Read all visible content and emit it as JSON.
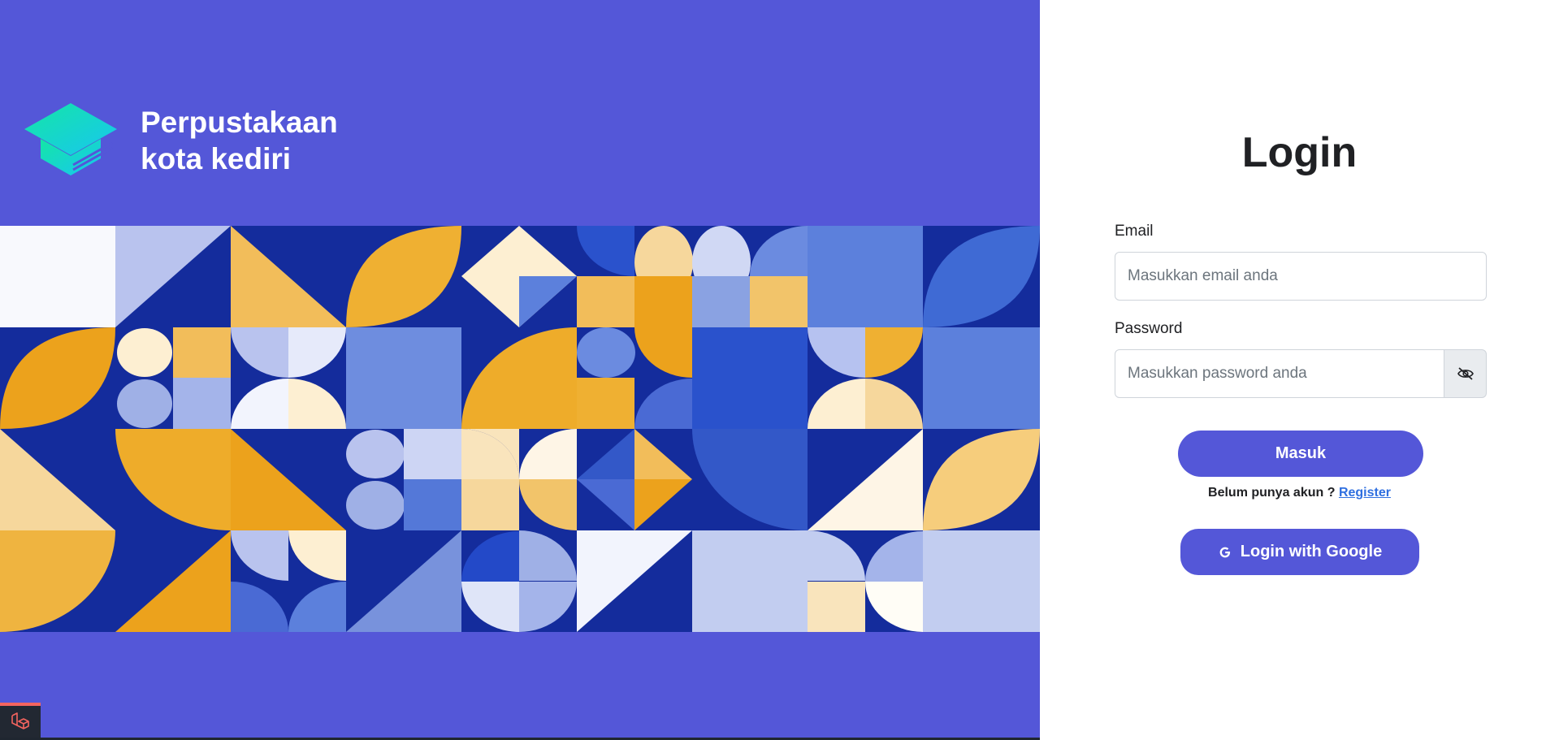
{
  "brand": {
    "line1": "Perpustakaan",
    "line2": "kota kediri",
    "logo_icon": "graduation-cap-icon"
  },
  "colors": {
    "panel": "#5457d8",
    "button": "#5457d8",
    "link": "#2f6fe0",
    "mosaic_navy": "#142c9c",
    "mosaic_orange": "#eca21c",
    "mosaic_light_blue": "#b9c3ee",
    "mosaic_cream": "#fdefd2"
  },
  "login": {
    "title": "Login",
    "email_label": "Email",
    "email_placeholder": "Masukkan email anda",
    "password_label": "Password",
    "password_placeholder": "Masukkan password anda",
    "toggle_icon": "eye-slash-icon",
    "submit_label": "Masuk",
    "signup_prompt": "Belum punya akun ?",
    "signup_link": "Register",
    "google_label": "Login with Google",
    "google_icon": "google-g-icon"
  },
  "debug": {
    "icon": "laravel-icon"
  }
}
